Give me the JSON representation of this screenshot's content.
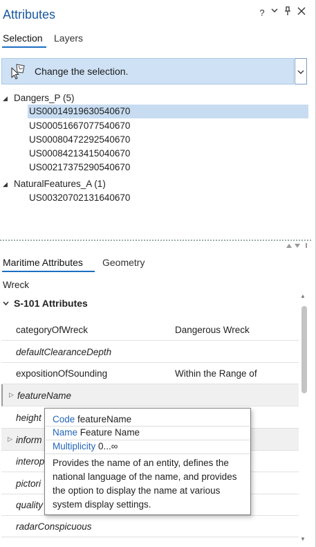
{
  "window": {
    "title": "Attributes",
    "buttons": {
      "help": "?",
      "menu": "⌄",
      "pin": "⊥",
      "close": "✕"
    }
  },
  "top_tabs": [
    "Selection",
    "Layers"
  ],
  "selection_tool": {
    "label": "Change the selection."
  },
  "tree": {
    "groups": [
      {
        "label": "Dangers_P (5)",
        "items": [
          "US00014919630540670",
          "US00051667077540670",
          "US00080472292540670",
          "US00084213415040670",
          "US00217375290540670"
        ],
        "selected_index": 0
      },
      {
        "label": "NaturalFeatures_A (1)",
        "items": [
          "US00320702131640670"
        ]
      }
    ]
  },
  "bottom_tabs": [
    "Maritime Attributes",
    "Geometry"
  ],
  "feature_class": "Wreck",
  "attributes": {
    "group_label": "S-101 Attributes",
    "rows": [
      {
        "name": "categoryOfWreck",
        "value": "Dangerous Wreck"
      },
      {
        "name": "defaultClearanceDepth",
        "value": ""
      },
      {
        "name": "expositionOfSounding",
        "value": "Within the Range of"
      },
      {
        "name": "featureName",
        "value": ""
      },
      {
        "name": "height",
        "value": ""
      },
      {
        "name": "information",
        "value": ""
      },
      {
        "name": "interoperabilityIdentifier",
        "value": ""
      },
      {
        "name": "pictorialRepresentation",
        "value": ""
      },
      {
        "name": "qualityOfVerticalMeasurement",
        "value": ""
      },
      {
        "name": "radarConspicuous",
        "value": ""
      }
    ],
    "visible_names": [
      "categoryOfWreck",
      "defaultClearanceDepth",
      "expositionOfSounding",
      "featureName",
      "height",
      "inform",
      "interop",
      "pictori",
      "quality",
      "radarConspicuous"
    ]
  },
  "tooltip": {
    "code_key": "Code",
    "code_val": "featureName",
    "name_key": "Name",
    "name_val": "Feature Name",
    "mult_key": "Multiplicity",
    "mult_val": "0...∞",
    "description": "Provides the name of an entity, defines the national language of the name, and provides the option to display the name at various system display settings."
  },
  "colors": {
    "accent": "#1a6ec2",
    "title": "#1a5aa0",
    "selection_bg": "#c7dcf1"
  }
}
